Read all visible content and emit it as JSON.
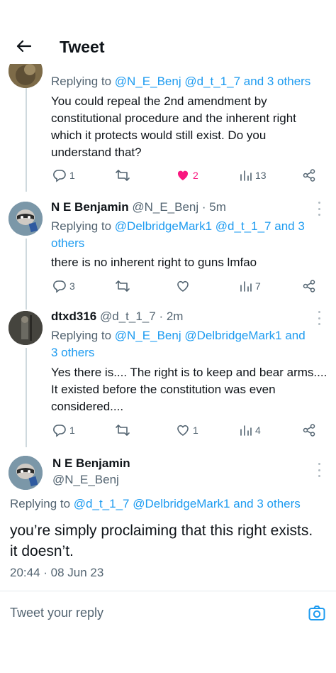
{
  "header": {
    "title": "Tweet"
  },
  "tweets": [
    {
      "reply_prefix": "Replying to",
      "mentions": [
        "@N_E_Benj",
        "@d_t_1_7"
      ],
      "and_others": "and 3 others",
      "text": "You could repeal the 2nd amendment by constitutional procedure and the inherent right which it protects would still exist. Do you understand that?",
      "replies": "1",
      "retweets": "",
      "likes": "2",
      "views": "13"
    },
    {
      "name": "N E Benjamin",
      "handle": "@N_E_Benj",
      "time": "· 5m",
      "reply_prefix": "Replying to",
      "mentions": [
        "@DelbridgeMark1",
        "@d_t_1_7"
      ],
      "and_others_1": "and 3",
      "and_others_2": "others",
      "text": "there is no inherent right to guns lmfao",
      "replies": "3",
      "retweets": "",
      "likes": "",
      "views": "7"
    },
    {
      "name": "dtxd316",
      "handle": "@d_t_1_7",
      "time": "· 2m",
      "reply_prefix": "Replying to",
      "mentions": [
        "@N_E_Benj",
        "@DelbridgeMark1"
      ],
      "and_others_1": "and",
      "and_others_2": "3 others",
      "text": "Yes there is.... The right is to keep and bear arms.... It existed before the constitution was even considered....",
      "replies": "1",
      "retweets": "",
      "likes": "1",
      "views": "4"
    }
  ],
  "focus": {
    "name": "N E Benjamin",
    "handle": "@N_E_Benj",
    "reply_prefix": "Replying to",
    "mentions": [
      "@d_t_1_7",
      "@DelbridgeMark1"
    ],
    "and_others": "and 3 others",
    "text": "you’re simply proclaiming that this right exists. it doesn’t.",
    "timestamp": "20:44 · 08 Jun 23"
  },
  "reply_bar": {
    "placeholder": "Tweet your reply"
  },
  "colors": {
    "accent": "#1d9bf0",
    "like": "#f91880",
    "muted": "#536471",
    "text": "#0f1419"
  },
  "icons": [
    "back-arrow-icon",
    "reply-icon",
    "retweet-icon",
    "heart-icon",
    "views-icon",
    "share-icon",
    "more-icon",
    "camera-icon"
  ]
}
